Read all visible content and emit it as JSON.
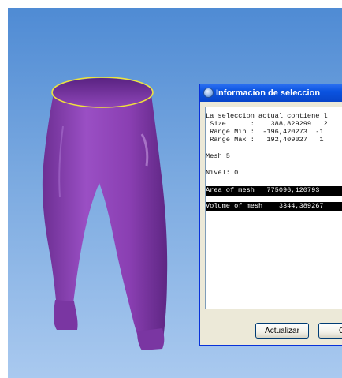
{
  "dialog": {
    "title": "Informacion de seleccion",
    "lines": {
      "l1": "La seleccion actual contiene l",
      "l2": " Size      :    388,829299   2",
      "l3": " Range Min :  -196,420273  -1",
      "l4": " Range Max :   192,409027   1",
      "l5": "Mesh 5",
      "l6": "Nivel: 0",
      "l7": "Area of mesh   775096,120793",
      "l8": "Volume of mesh    3344,389267"
    },
    "buttons": {
      "update": "Actualizar",
      "close_partial": "Cc"
    }
  },
  "colors": {
    "viewport_bg": "#6f9fdc",
    "mesh": "#8a3fb2",
    "selection_outline": "#f1e33a",
    "titlebar": "#0a53e0"
  },
  "icons": {
    "title_icon": "globe-icon"
  }
}
